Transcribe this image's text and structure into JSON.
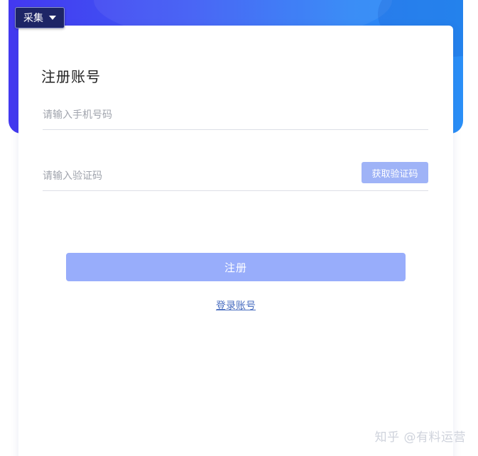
{
  "toolbar": {
    "collect_label": "采集"
  },
  "form": {
    "title": "注册账号",
    "phone_placeholder": "请输入手机号码",
    "code_placeholder": "请输入验证码",
    "get_code_label": "获取验证码",
    "register_label": "注册",
    "login_link_label": "登录账号"
  },
  "watermark": {
    "text": "知乎 @有料运营"
  },
  "colors": {
    "brand_blue": "#3f5cf5",
    "button_disabled_blue": "#98adfb",
    "link_blue": "#4a6ec0"
  }
}
